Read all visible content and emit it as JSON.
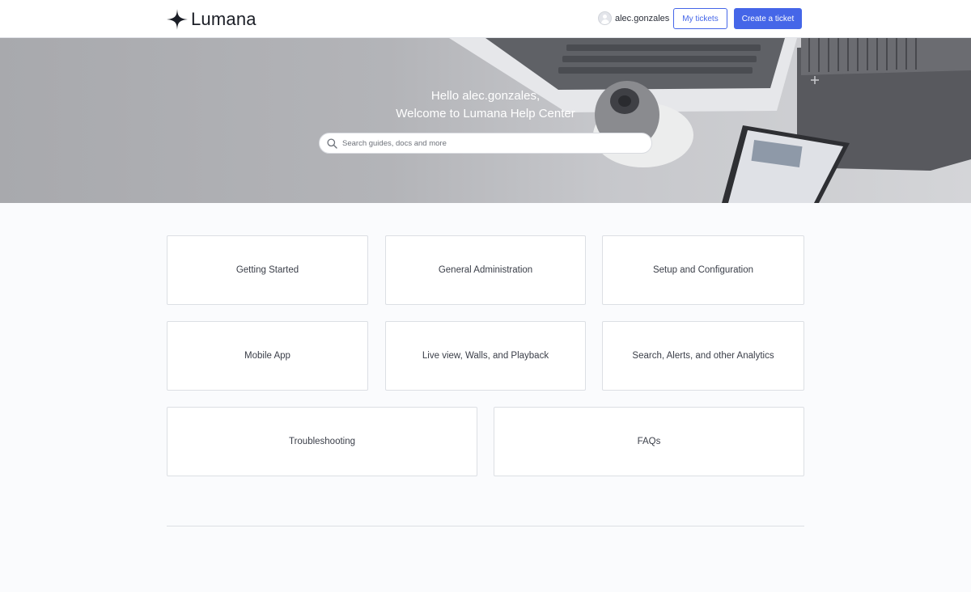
{
  "header": {
    "logo_text": "Lumana",
    "username": "alec.gonzales",
    "my_tickets_label": "My tickets",
    "create_ticket_label": "Create a ticket"
  },
  "hero": {
    "greeting_line1": "Hello alec.gonzales,",
    "greeting_line2": "Welcome to Lumana Help Center",
    "search_placeholder": "Search guides, docs and more"
  },
  "categories": [
    {
      "label": "Getting Started"
    },
    {
      "label": "General Administration"
    },
    {
      "label": "Setup and Configuration"
    },
    {
      "label": "Mobile App"
    },
    {
      "label": "Live view, Walls, and Playback"
    },
    {
      "label": "Search, Alerts, and other Analytics"
    },
    {
      "label": "Troubleshooting"
    },
    {
      "label": "FAQs"
    }
  ],
  "colors": {
    "accent": "#4566e8",
    "page_background": "#fafbfd",
    "card_border": "#dcdfe4"
  },
  "icons": [
    "lumana-logo-icon",
    "avatar-icon",
    "search-icon"
  ]
}
